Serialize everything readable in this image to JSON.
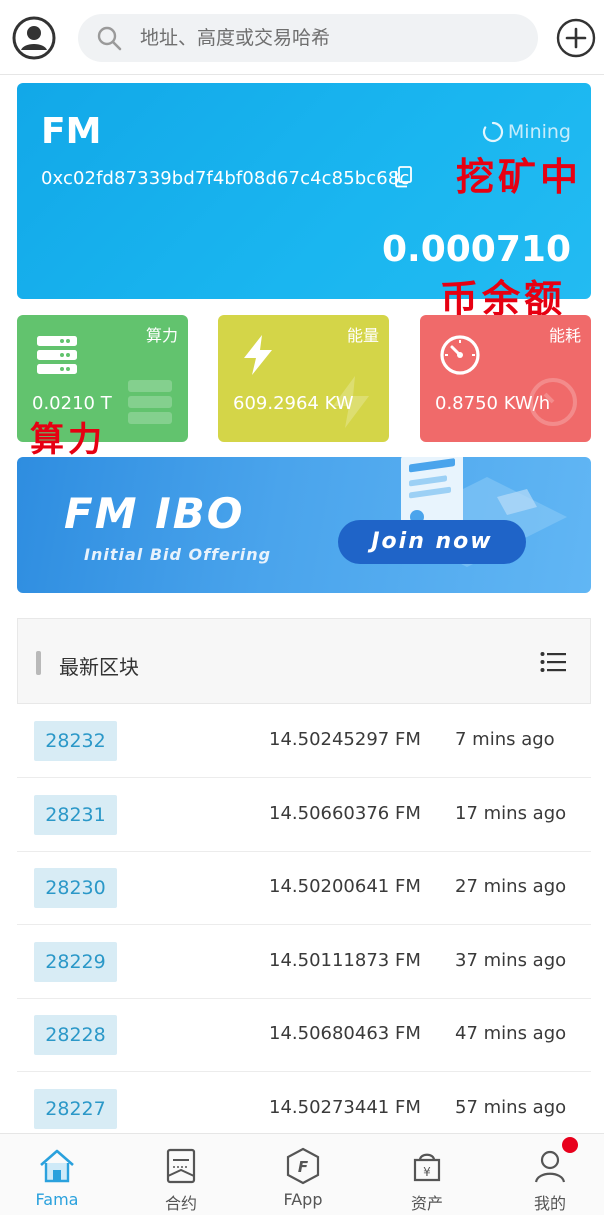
{
  "search": {
    "placeholder": "地址、高度或交易哈希"
  },
  "card": {
    "coin": "FM",
    "address": "0xc02fd87339bd7f4bf08d67c4c85bc68c",
    "status": "Mining",
    "balance": "0.000710"
  },
  "annotations": {
    "mining": "挖矿中",
    "balance": "币余额",
    "hashrate": "算力"
  },
  "stats": [
    {
      "title": "算力",
      "value": "0.0210 T",
      "icon": "server-icon",
      "color": "#62c36e"
    },
    {
      "title": "能量",
      "value": "609.2964 KW",
      "icon": "lightning-icon",
      "color": "#d4d548"
    },
    {
      "title": "能耗",
      "value": "0.8750 KW/h",
      "icon": "gauge-icon",
      "color": "#f06a6a"
    }
  ],
  "banner": {
    "title": "FM IBO",
    "subtitle": "Initial Bid Offering",
    "button": "Join now"
  },
  "blocks": {
    "title": "最新区块",
    "rows": [
      {
        "height": "28232",
        "amount": "14.50245297 FM",
        "time": "7 mins ago"
      },
      {
        "height": "28231",
        "amount": "14.50660376 FM",
        "time": "17 mins ago"
      },
      {
        "height": "28230",
        "amount": "14.50200641 FM",
        "time": "27 mins ago"
      },
      {
        "height": "28229",
        "amount": "14.50111873 FM",
        "time": "37 mins ago"
      },
      {
        "height": "28228",
        "amount": "14.50680463 FM",
        "time": "47 mins ago"
      },
      {
        "height": "28227",
        "amount": "14.50273441 FM",
        "time": "57 mins ago"
      }
    ]
  },
  "nav": [
    {
      "label": "Fama",
      "icon": "home-icon",
      "active": true
    },
    {
      "label": "合约",
      "icon": "contract-icon",
      "active": false
    },
    {
      "label": "FApp",
      "icon": "fapp-icon",
      "active": false
    },
    {
      "label": "资产",
      "icon": "wallet-icon",
      "active": false
    },
    {
      "label": "我的",
      "icon": "profile-icon",
      "active": false
    }
  ],
  "colors": {
    "accent": "#2aa1dd",
    "card": "#1ab6f0",
    "badge_dot": "#e8001c",
    "annotation": "#e60012"
  }
}
